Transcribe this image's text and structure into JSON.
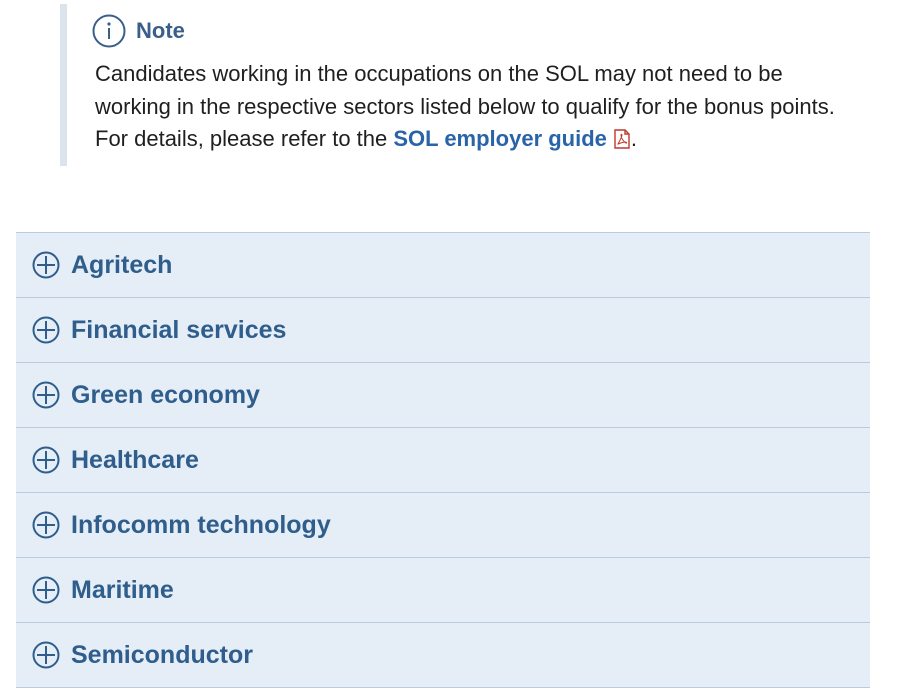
{
  "note": {
    "title": "Note",
    "icon": "info-icon",
    "body_text": "Candidates working in the occupations on the SOL may not need to be working in the respective sectors listed below to qualify for the bonus points. For details, please refer to the ",
    "link_text": "SOL employer guide",
    "link_icon": "pdf-icon",
    "trailing": "."
  },
  "accordion": {
    "expand_icon": "plus-circle-icon",
    "items": [
      {
        "label": "Agritech"
      },
      {
        "label": "Financial services"
      },
      {
        "label": "Green economy"
      },
      {
        "label": "Healthcare"
      },
      {
        "label": "Infocomm technology"
      },
      {
        "label": "Maritime"
      },
      {
        "label": "Semiconductor"
      }
    ]
  },
  "colors": {
    "accent": "#2f5d8c",
    "link": "#2a64a8",
    "accordion_bg": "#e5eef7",
    "divider": "#b9cbdd",
    "note_border": "#dbe3ec",
    "pdf_red": "#c0392b"
  }
}
